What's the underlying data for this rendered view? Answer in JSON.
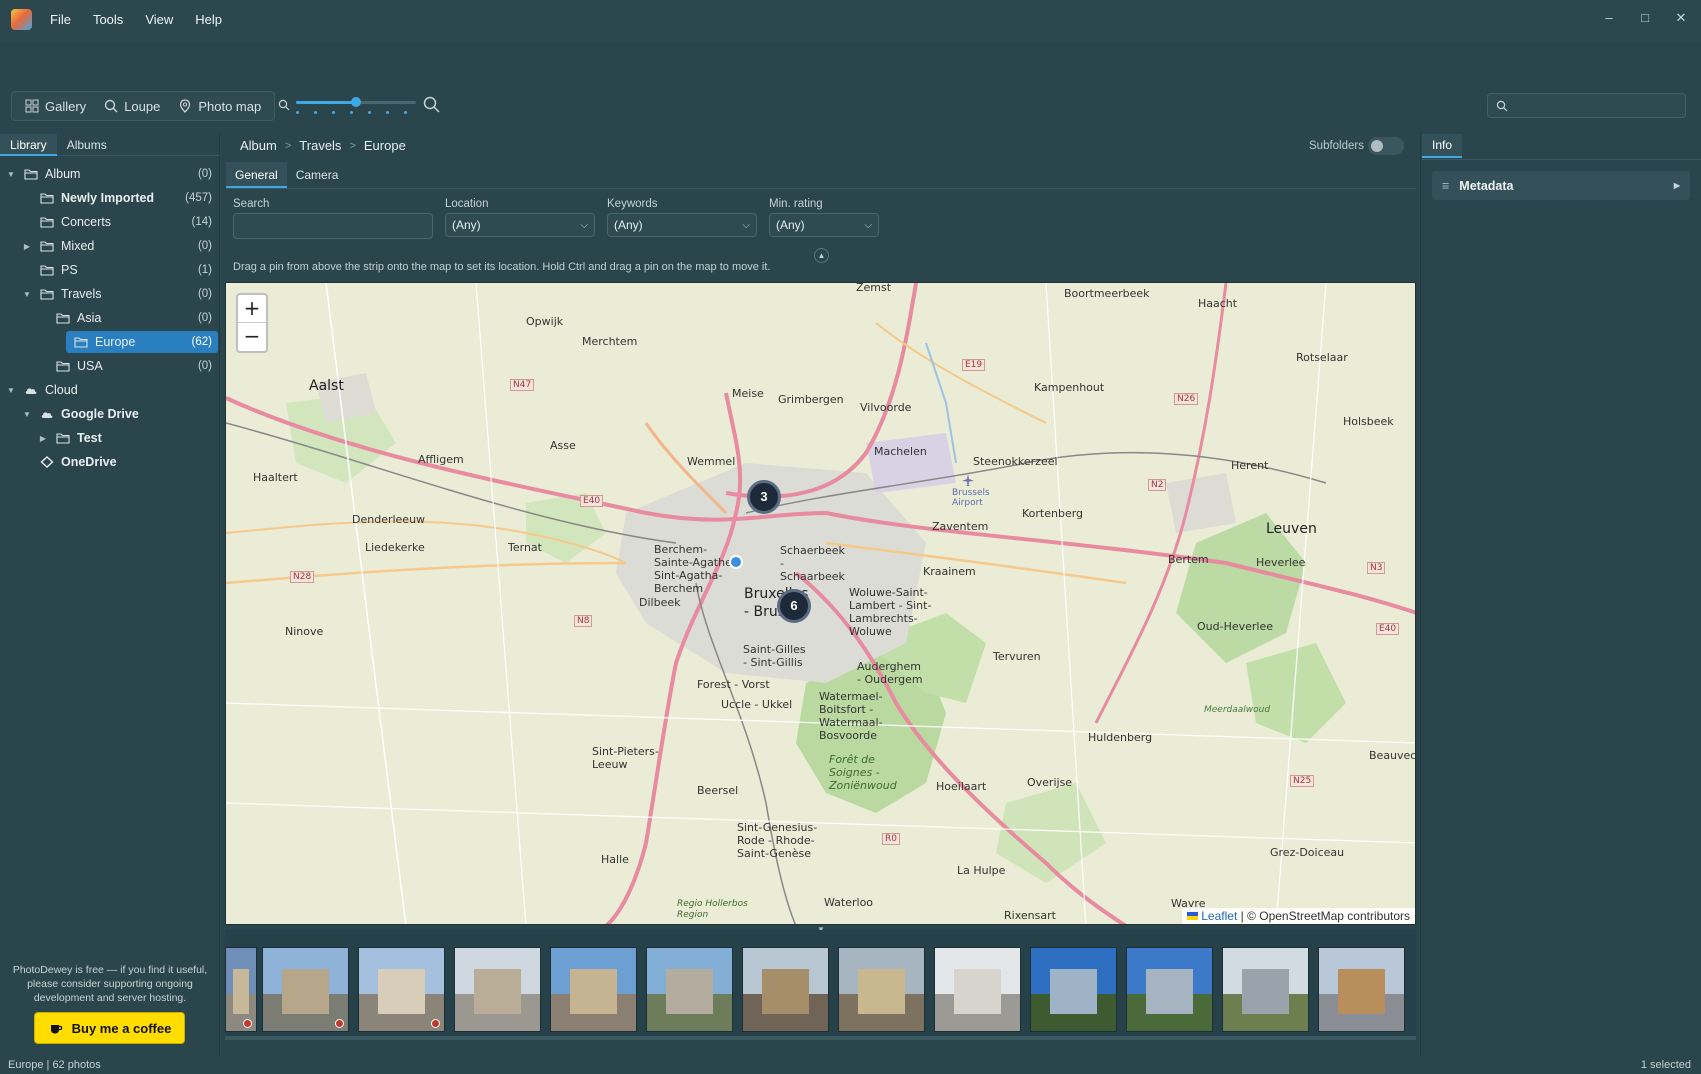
{
  "menu": [
    "File",
    "Tools",
    "View",
    "Help"
  ],
  "window_controls": {
    "minimize": "–",
    "maximize": "□",
    "close": "✕"
  },
  "toolbar": {
    "views": [
      {
        "label": "Gallery",
        "icon": "grid-icon"
      },
      {
        "label": "Loupe",
        "icon": "magnifier-icon"
      },
      {
        "label": "Photo map",
        "icon": "map-pin-icon"
      }
    ],
    "zoom_level": 0.5,
    "search_placeholder": ""
  },
  "left_tabs": [
    "Library",
    "Albums"
  ],
  "tree": [
    {
      "label": "Album",
      "count": "(0)",
      "depth": 0,
      "arrow": "▼",
      "icon": "folder",
      "bold": false
    },
    {
      "label": "Newly Imported",
      "count": "(457)",
      "depth": 1,
      "arrow": "",
      "icon": "folder",
      "bold": true
    },
    {
      "label": "Concerts",
      "count": "(14)",
      "depth": 1,
      "arrow": "",
      "icon": "folder",
      "bold": false
    },
    {
      "label": "Mixed",
      "count": "(0)",
      "depth": 1,
      "arrow": "▶",
      "icon": "folder",
      "bold": false
    },
    {
      "label": "PS",
      "count": "(1)",
      "depth": 1,
      "arrow": "",
      "icon": "folder",
      "bold": false
    },
    {
      "label": "Travels",
      "count": "(0)",
      "depth": 1,
      "arrow": "▼",
      "icon": "folder",
      "bold": false
    },
    {
      "label": "Asia",
      "count": "(0)",
      "depth": 2,
      "arrow": "",
      "icon": "folder",
      "bold": false
    },
    {
      "label": "Europe",
      "count": "(62)",
      "depth": 2,
      "arrow": "",
      "icon": "folder",
      "bold": false,
      "selected": true
    },
    {
      "label": "USA",
      "count": "(0)",
      "depth": 2,
      "arrow": "",
      "icon": "folder",
      "bold": false
    },
    {
      "label": "Cloud",
      "count": "",
      "depth": 0,
      "arrow": "▼",
      "icon": "cloud",
      "bold": false
    },
    {
      "label": "Google Drive",
      "count": "",
      "depth": 1,
      "arrow": "▼",
      "icon": "cloud",
      "bold": true
    },
    {
      "label": "Test",
      "count": "",
      "depth": 2,
      "arrow": "▶",
      "icon": "folder",
      "bold": true
    },
    {
      "label": "OneDrive",
      "count": "",
      "depth": 1,
      "arrow": "",
      "icon": "diamond",
      "bold": true
    }
  ],
  "donate": {
    "text": "PhotoDewey is free — if you find it useful, please consider supporting ongoing development and server hosting.",
    "button": "Buy me a coffee"
  },
  "breadcrumb": [
    "Album",
    "Travels",
    "Europe"
  ],
  "subfolders_label": "Subfolders",
  "subfolders_on": false,
  "center_tabs": [
    "General",
    "Camera"
  ],
  "filters": {
    "search_label": "Search",
    "search_value": "",
    "location_label": "Location",
    "location_value": "(Any)",
    "keywords_label": "Keywords",
    "keywords_value": "(Any)",
    "rating_label": "Min. rating",
    "rating_value": "(Any)"
  },
  "hint": "Drag a pin from above the strip onto the map to set its location. Hold Ctrl and drag a pin on the map to move it.",
  "map": {
    "zoom_in": "+",
    "zoom_out": "−",
    "clusters": [
      "3",
      "6"
    ],
    "labels": {
      "zemst": "Zemst",
      "boortmeerbeek": "Boortmeerbeek",
      "haacht": "Haacht",
      "opwijk": "Opwijk",
      "merchtem": "Merchtem",
      "rotselaar": "Rotselaar",
      "aalst": "Aalst",
      "meise": "Meise",
      "grimbergen": "Grimbergen",
      "vilvoorde": "Vilvoorde",
      "kampenhout": "Kampenhout",
      "holsbeek": "Holsbeek",
      "affligem": "Affligem",
      "asse": "Asse",
      "wemmel": "Wemmel",
      "machelen": "Machelen",
      "steenokkerzeel": "Steenokkerzeel",
      "herent": "Herent",
      "haaltert": "Haaltert",
      "brussels_airport": "Brussels Airport",
      "kortenberg": "Kortenberg",
      "zaventem": "Zaventem",
      "leuven": "Leuven",
      "denderleeuw": "Denderleeuw",
      "liedekerke": "Liedekerke",
      "ternat": "Ternat",
      "berchem": "Berchem-Sainte-Agathe - Sint-Agatha-Berchem",
      "schaerbeek": "Schaerbeek - Schaarbeek",
      "bertem": "Bertem",
      "heverlee": "Heverlee",
      "kraainem": "Kraainem",
      "dilbeek": "Dilbeek",
      "bruxelles": "Bruxelles - Brussel",
      "woluwe": "Woluwe-Saint-Lambert - Sint-Lambrechts-Woluwe",
      "ninove": "Ninove",
      "oud_heverlee": "Oud-Heverlee",
      "saint_gilles": "Saint-Gilles - Sint-Gillis",
      "tervuren": "Tervuren",
      "forest": "Forest - Vorst",
      "auderghem": "Auderghem - Oudergem",
      "uccle": "Uccle - Ukkel",
      "watermael": "Watermael-Boitsfort - Watermaal-Bosvoorde",
      "meerdaalwoud": "Meerdaalwoud",
      "huldenberg": "Huldenberg",
      "sint_pieters": "Sint-Pieters-Leeuw",
      "beauvechain": "Beauvecha",
      "foret": "Forêt de Soignes - Zoniënwoud",
      "overijse": "Overijse",
      "hoeilaart": "Hoeilaart",
      "beersel": "Beersel",
      "sint_genesius": "Sint-Genesius-Rode - Rhode-Saint-Genèse",
      "grez": "Grez-Doiceau",
      "halle": "Halle",
      "la_hulpe": "La Hulpe",
      "wavre": "Wavre",
      "waterloo": "Waterloo",
      "rixensart": "Rixensart",
      "regio": "Regio Hollerbos Region",
      "n47": "N47",
      "e19": "E19",
      "n26": "N26",
      "e40": "E40",
      "n2": "N2",
      "n28": "N28",
      "n8": "N8",
      "n3": "N3",
      "e40b": "E40",
      "n25": "N25",
      "r0": "R0"
    },
    "attribution_link": "Leaflet",
    "attribution_text": "| © OpenStreetMap contributors"
  },
  "info_tab": "Info",
  "metadata_label": "Metadata",
  "status": {
    "left": "Europe | 62 photos",
    "right": "1 selected"
  },
  "colors": {
    "accent": "#3fa9e6",
    "background": "#2b454c",
    "coffee": "#ffdd00",
    "selected": "#2a7fc1"
  }
}
